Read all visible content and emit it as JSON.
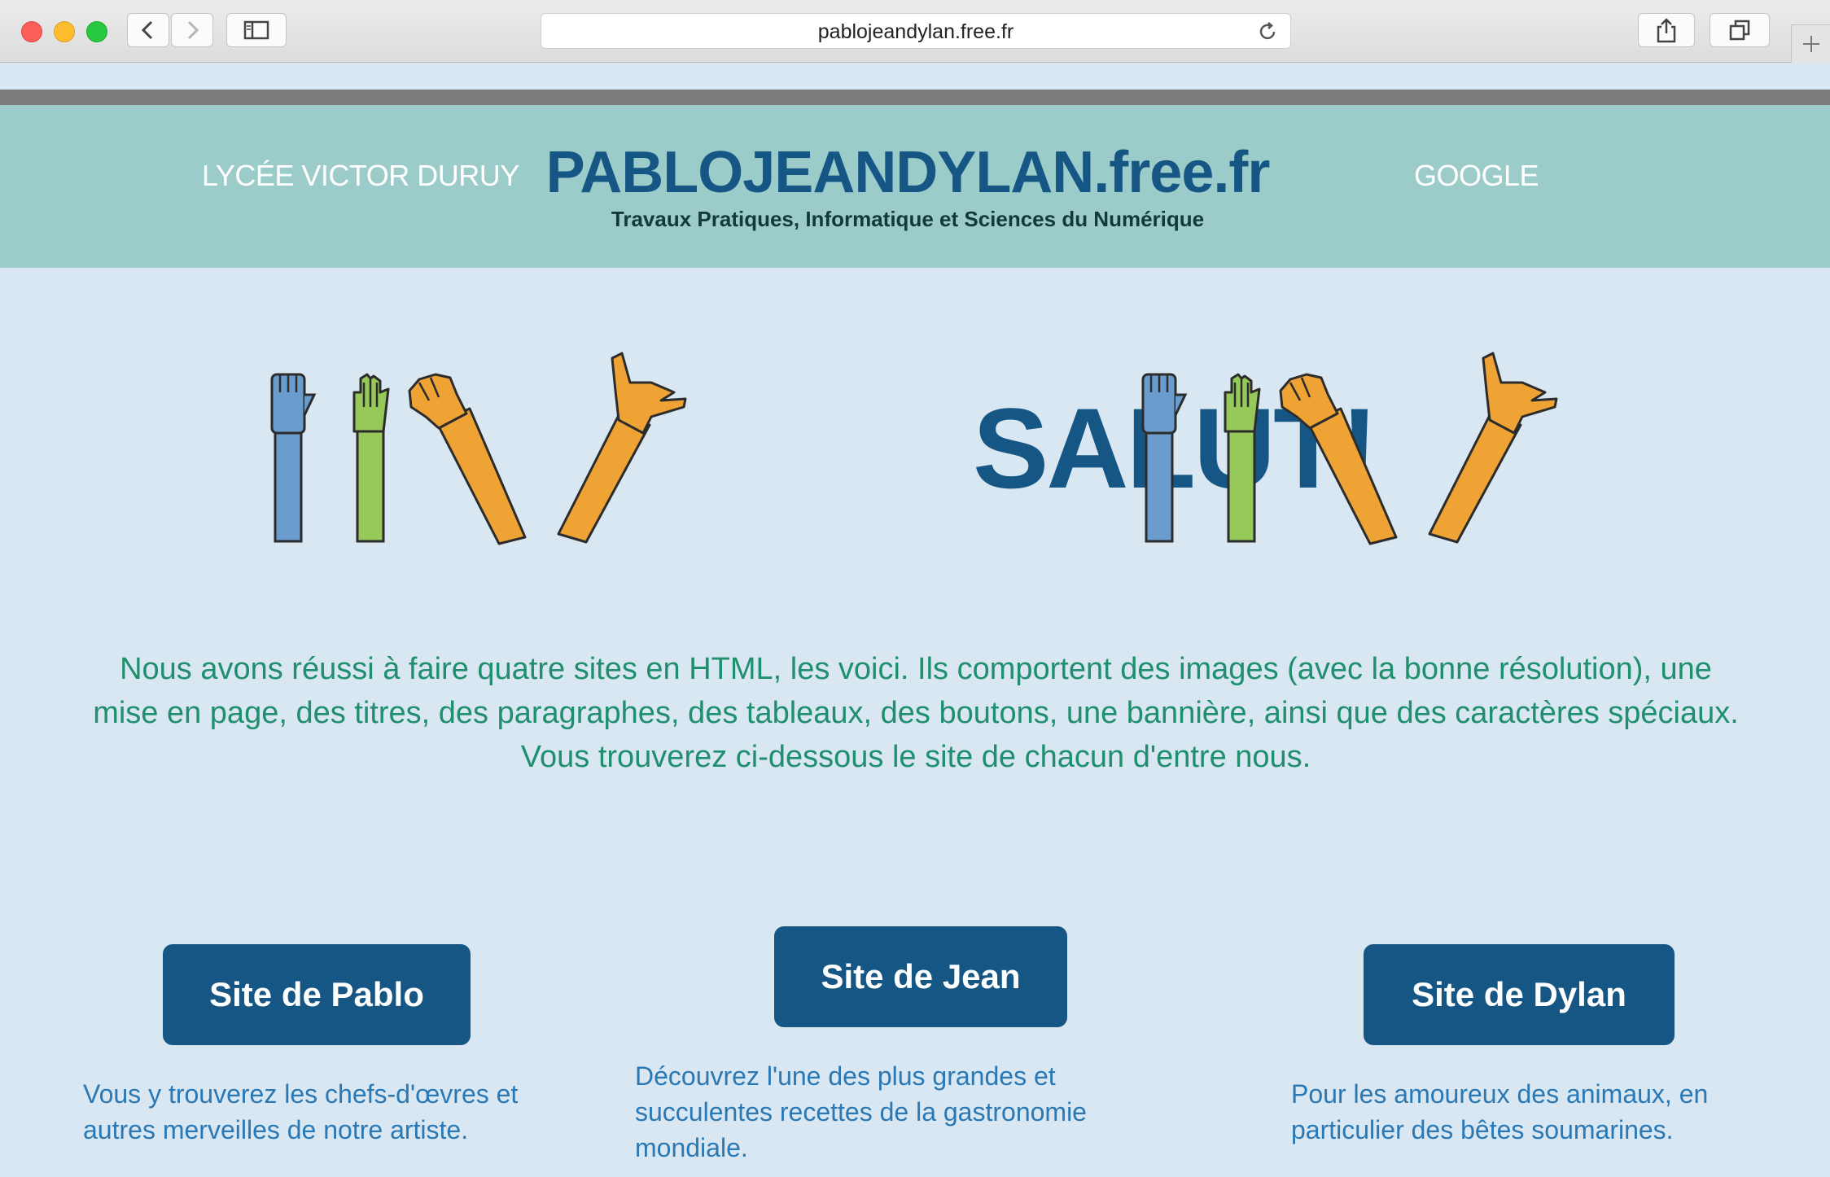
{
  "browser": {
    "url": "pablojeandylan.free.fr"
  },
  "header": {
    "nav_left": "LYCÉE VICTOR DURUY",
    "title": "PABLOJEANDYLAN.free.fr",
    "subtitle": "Travaux Pratiques, Informatique et Sciences du Numérique",
    "nav_right": "GOOGLE"
  },
  "hero": {
    "title": "SALUT!",
    "arm_colors": {
      "blue": "#6a9ccd",
      "green": "#96c95a",
      "orange": "#eea334",
      "outline": "#2c2c2c"
    }
  },
  "intro": {
    "text": "Nous avons réussi à faire quatre sites en HTML, les voici. Ils comportent des images (avec la bonne résolution), une mise en page, des titres, des paragraphes, des tableaux, des boutons, une bannière, ainsi que des caractères spéciaux. Vous trouverez ci-dessous le site de chacun d'entre nous."
  },
  "sites": [
    {
      "button": "Site de Pablo",
      "description": "Vous y trouverez les chefs-d'œvres et autres merveilles de notre artiste."
    },
    {
      "button": "Site de Jean",
      "description": "Découvrez l'une des plus grandes et succulentes recettes de la gastronomie mondiale."
    },
    {
      "button": "Site de Dylan",
      "description": "Pour les amoureux des animaux, en particulier des bêtes soumarines."
    }
  ],
  "colors": {
    "page_bg": "#d8e7f2",
    "header_bg": "#9cccc9",
    "brand": "#165685",
    "intro_text": "#1f8f6e",
    "desc_text": "#2a78b4"
  }
}
